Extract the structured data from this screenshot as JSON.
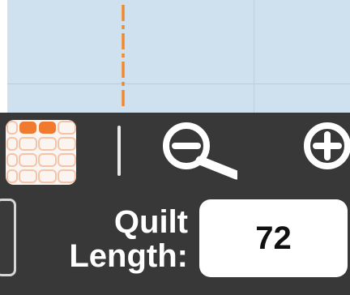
{
  "canvas": {
    "background_color": "#cfe0ef",
    "guide_color": "#f08a2a"
  },
  "toolbar": {
    "background_color": "#383838",
    "tiles_button": {
      "icon": "block-grid-icon",
      "accent_color": "#f07a30"
    },
    "zoom_out": {
      "icon": "zoom-out-icon"
    },
    "zoom_in": {
      "icon": "zoom-in-icon"
    }
  },
  "quilt_length": {
    "label_line1": "Quilt",
    "label_line2": "Length:",
    "value": "72"
  }
}
